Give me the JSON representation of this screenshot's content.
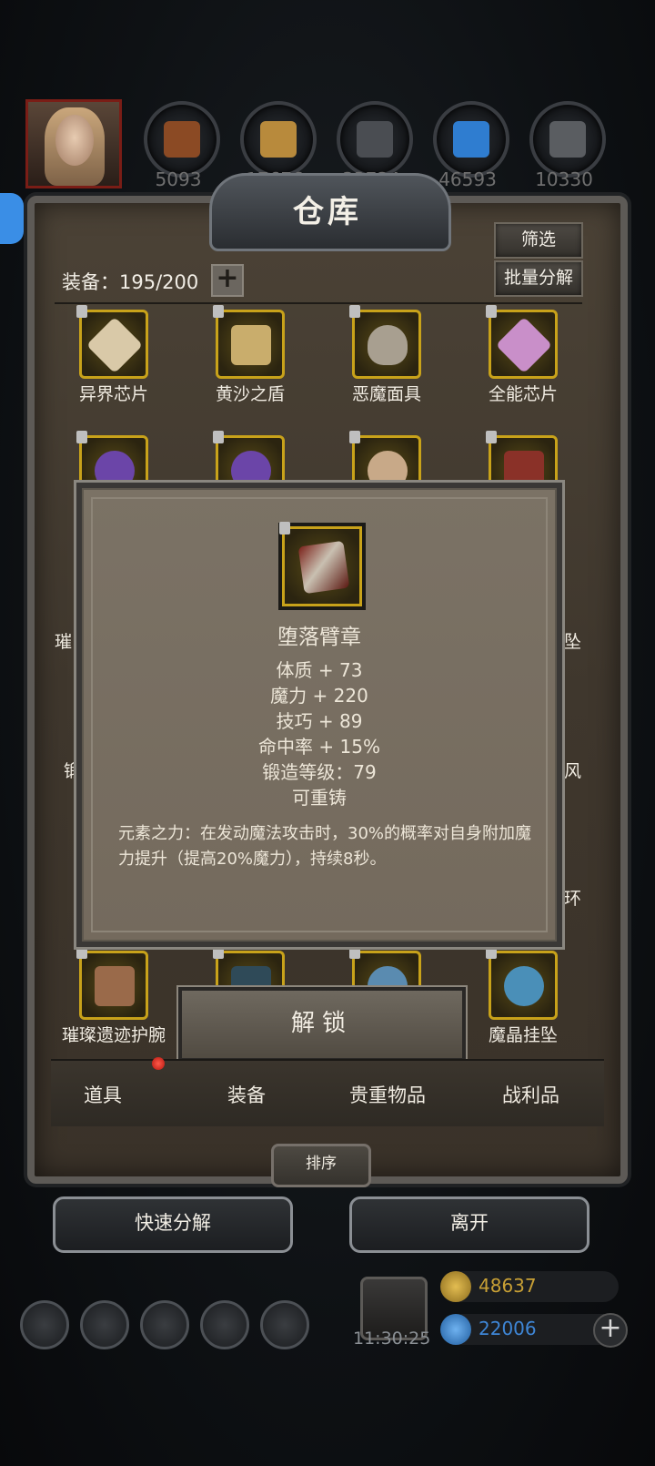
{
  "resources": {
    "counts": [
      "5093",
      "17676",
      "33734",
      "46593",
      "10330"
    ],
    "colors": [
      "#8b4a24",
      "#b88a3c",
      "#4a4d52",
      "#2f7dd0",
      "#5a5d61"
    ]
  },
  "panel": {
    "title": "仓库",
    "filter_label": "筛选",
    "batch_label": "批量分解",
    "capacity_label": "装备：195/200",
    "add_symbol": "+"
  },
  "items": {
    "row1": [
      {
        "name": "异界芯片",
        "color": "#d9c9a8"
      },
      {
        "name": "黄沙之盾",
        "color": "#c9ad6c"
      },
      {
        "name": "恶魔面具",
        "color": "#a89f90"
      },
      {
        "name": "全能芯片",
        "color": "#c98fc9"
      }
    ],
    "row2": [
      {
        "color": "#6b45a8"
      },
      {
        "color": "#6b45a8"
      },
      {
        "color": "#c8a988"
      },
      {
        "color": "#8a3128"
      }
    ],
    "row_last": [
      {
        "name": "璀璨遗迹护腕",
        "color": "#9a6a4a"
      },
      {
        "name": "",
        "color": "#2f4a58"
      },
      {
        "name": "",
        "color": "#5a8bb0"
      },
      {
        "name": "魔晶挂坠",
        "color": "#4a8fb8"
      }
    ],
    "side_fragments": {
      "left1": "璀",
      "left2": "锻",
      "right1": "坠",
      "right2": "风",
      "right3": "环"
    }
  },
  "tooltip": {
    "name": "堕落臂章",
    "stats": [
      "体质 + 73",
      "魔力 + 220",
      "技巧 + 89",
      "命中率 + 15%",
      "锻造等级：79",
      "可重铸"
    ],
    "description": "元素之力：在发动魔法攻击时，30%的概率对自身附加魔力提升（提高20%魔力），持续8秒。"
  },
  "unlock_label": "解锁",
  "tabs": [
    "道具",
    "装备",
    "贵重物品",
    "战利品"
  ],
  "sort_label": "排序",
  "quick_decompose_label": "快速分解",
  "leave_label": "离开",
  "status": {
    "time": "11:30:25",
    "gold": "48637",
    "gems": "22006",
    "gold_color": "#c8a035",
    "gem_color": "#3e86d6"
  }
}
